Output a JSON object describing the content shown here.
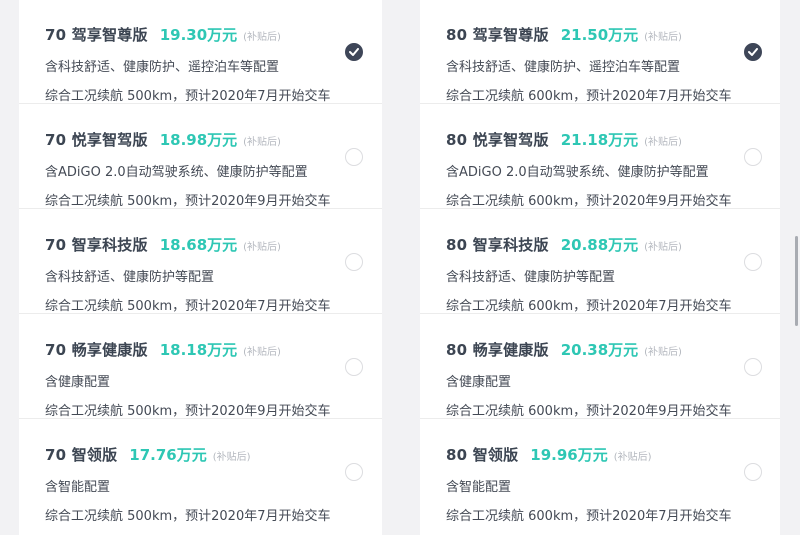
{
  "subsidy_label": "(补贴后)",
  "accent_color": "#2ec7b4",
  "selected_color": "#3e4658",
  "columns": [
    {
      "items": [
        {
          "name": "70 驾享智尊版",
          "price": "19.30万元",
          "feature": "含科技舒适、健康防护、遥控泊车等配置",
          "range": "综合工况续航 500km，预计2020年7月开始交车",
          "selected": true
        },
        {
          "name": "70 悦享智驾版",
          "price": "18.98万元",
          "feature": "含ADiGO 2.0自动驾驶系统、健康防护等配置",
          "range": "综合工况续航 500km，预计2020年9月开始交车",
          "selected": false
        },
        {
          "name": "70 智享科技版",
          "price": "18.68万元",
          "feature": "含科技舒适、健康防护等配置",
          "range": "综合工况续航 500km，预计2020年7月开始交车",
          "selected": false
        },
        {
          "name": "70 畅享健康版",
          "price": "18.18万元",
          "feature": "含健康配置",
          "range": "综合工况续航 500km，预计2020年9月开始交车",
          "selected": false
        },
        {
          "name": "70 智领版",
          "price": "17.76万元",
          "feature": "含智能配置",
          "range": "综合工况续航 500km，预计2020年7月开始交车",
          "selected": false
        }
      ]
    },
    {
      "items": [
        {
          "name": "80 驾享智尊版",
          "price": "21.50万元",
          "feature": "含科技舒适、健康防护、遥控泊车等配置",
          "range": "综合工况续航 600km，预计2020年7月开始交车",
          "selected": true
        },
        {
          "name": "80 悦享智驾版",
          "price": "21.18万元",
          "feature": "含ADiGO 2.0自动驾驶系统、健康防护等配置",
          "range": "综合工况续航 600km，预计2020年9月开始交车",
          "selected": false
        },
        {
          "name": "80 智享科技版",
          "price": "20.88万元",
          "feature": "含科技舒适、健康防护等配置",
          "range": "综合工况续航 600km，预计2020年7月开始交车",
          "selected": false
        },
        {
          "name": "80 畅享健康版",
          "price": "20.38万元",
          "feature": "含健康配置",
          "range": "综合工况续航 600km，预计2020年9月开始交车",
          "selected": false
        },
        {
          "name": "80 智领版",
          "price": "19.96万元",
          "feature": "含智能配置",
          "range": "综合工况续航 600km，预计2020年7月开始交车",
          "selected": false
        }
      ]
    }
  ]
}
